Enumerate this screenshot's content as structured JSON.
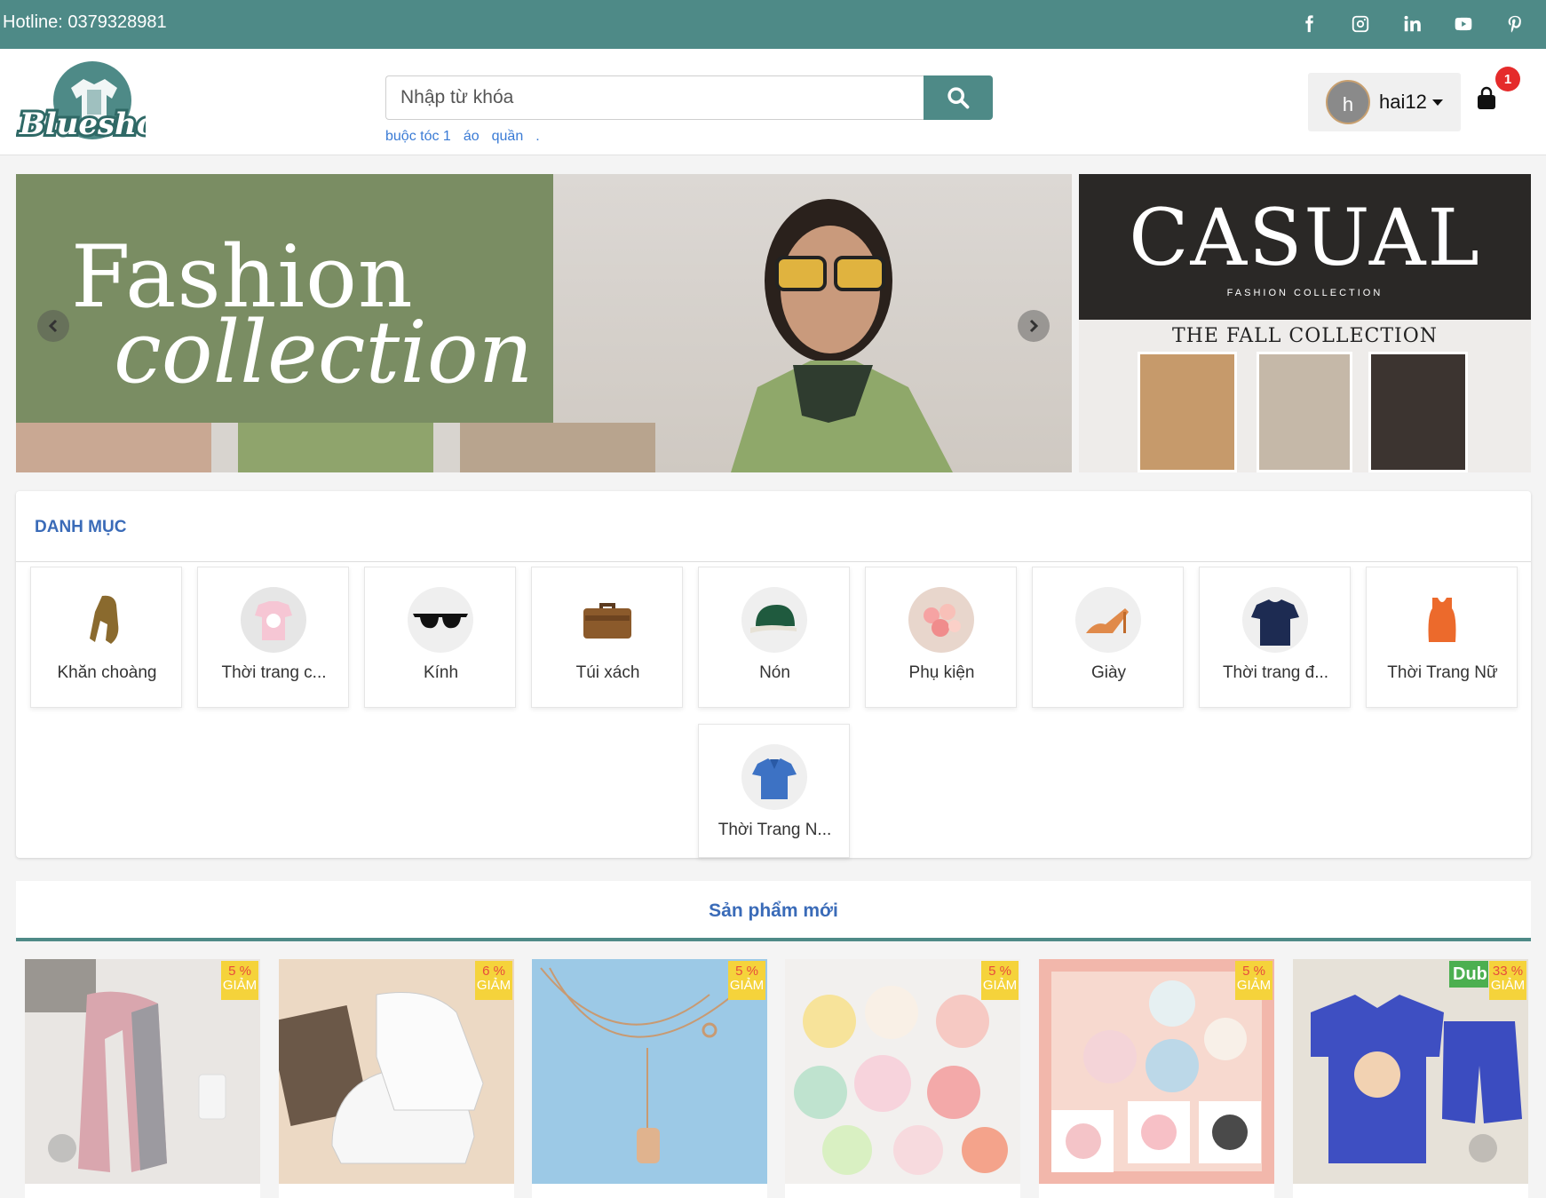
{
  "topbar": {
    "hotline": "Hotline: 0379328981",
    "socials": [
      "facebook-icon",
      "instagram-icon",
      "linkedin-icon",
      "youtube-icon",
      "pinterest-icon"
    ]
  },
  "header": {
    "logo_text": "Blueshop",
    "search_placeholder": "Nhập từ khóa",
    "suggestions": [
      "buộc tóc 1",
      "áo",
      "quần",
      "."
    ],
    "username": "hai12",
    "avatar_letter": "h",
    "cart_count": "1"
  },
  "banner": {
    "main_title1": "Fashion",
    "main_title2": "collection",
    "side_title": "CASUAL",
    "side_subtitle": "FASHION COLLECTION",
    "side_fall": "THE FALL COLLECTION"
  },
  "categories": {
    "title": "DANH MỤC",
    "items": [
      {
        "label": "Khăn choàng",
        "icon": "scarf-icon"
      },
      {
        "label": "Thời trang c...",
        "icon": "kids-clothes-icon"
      },
      {
        "label": "Kính",
        "icon": "sunglasses-icon"
      },
      {
        "label": "Túi xách",
        "icon": "bag-icon"
      },
      {
        "label": "Nón",
        "icon": "cap-icon"
      },
      {
        "label": "Phụ kiện",
        "icon": "accessories-icon"
      },
      {
        "label": "Giày",
        "icon": "heels-icon"
      },
      {
        "label": "Thời trang đ...",
        "icon": "tshirt-icon"
      },
      {
        "label": "Thời Trang Nữ",
        "icon": "tank-top-icon"
      },
      {
        "label": "Thời Trang N...",
        "icon": "polo-icon"
      }
    ]
  },
  "new_products": {
    "title": "Sản phẩm mới",
    "badge_label": "GIẢM",
    "items": [
      {
        "discount": "5 %",
        "image": "pink-scarf"
      },
      {
        "discount": "6 %",
        "image": "white-sneakers"
      },
      {
        "discount": "5 %",
        "image": "gold-necklace"
      },
      {
        "discount": "5 %",
        "image": "scrunchies-set"
      },
      {
        "discount": "5 %",
        "image": "scrunchies-pink"
      },
      {
        "discount": "33 %",
        "image": "blue-jersey-set",
        "overlay_text": "Dub"
      }
    ]
  },
  "colors": {
    "brand": "#4e8a87",
    "link": "#3a6bb8",
    "badge": "#f5d33b",
    "cart_badge": "#e52b2b"
  }
}
